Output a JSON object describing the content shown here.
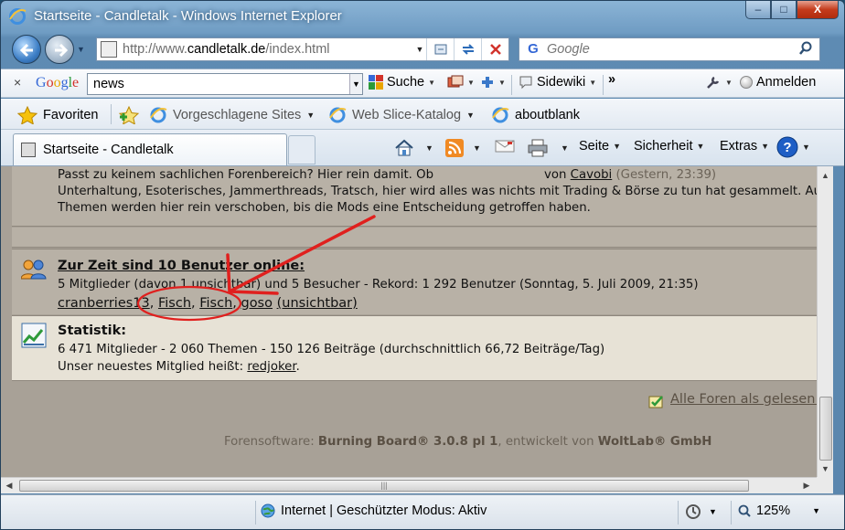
{
  "window": {
    "title": "Startseite - Candletalk - Windows Internet Explorer",
    "minimize": "–",
    "maximize": "□",
    "close": "X"
  },
  "nav": {
    "url_prefix": "http://www.",
    "url_domain": "candletalk.de",
    "url_suffix": "/index.html",
    "search_placeholder": "Google"
  },
  "google_toolbar": {
    "close": "×",
    "logo": "Google",
    "query": "news",
    "search_label": "Suche",
    "sidewiki_label": "Sidewiki",
    "more": "»",
    "signin_label": "Anmelden"
  },
  "favorites": {
    "favorites_label": "Favoriten",
    "suggested_label": "Vorgeschlagene Sites",
    "webslice_label": "Web Slice-Katalog",
    "aboutblank_label": "aboutblank"
  },
  "command_bar": {
    "tab_title": "Startseite - Candletalk",
    "page_label": "Seite",
    "safety_label": "Sicherheit",
    "extras_label": "Extras"
  },
  "forum": {
    "offtopic_desc_1": "Passt zu keinem sachlichen Forenbereich? Hier rein damit. Ob",
    "offtopic_desc_2": "Unterhaltung, Esoterisches, Jammerthreads, Tratsch, hier wird alles was nichts mit Trading & Börse zu tun hat gesammelt. Auch st",
    "offtopic_desc_3": "Themen werden hier rein verschoben, bis die Mods eine Entscheidung getroffen haben.",
    "lastpost_by": "von",
    "lastpost_user": "Cavobi",
    "lastpost_time": "(Gestern, 23:39)",
    "online_title": "Zur Zeit sind 10 Benutzer online:",
    "online_detail": "5 Mitglieder (davon 1 unsichtbar) und 5 Besucher - Rekord: 1 292 Benutzer (Sonntag, 5. Juli 2009, 21:35)",
    "online_users": [
      {
        "name": "cranberries13",
        "sep": ", "
      },
      {
        "name": "Fisch",
        "sep": ", "
      },
      {
        "name": "Fisch",
        "sep": ", "
      },
      {
        "name": "goso",
        "sep": " "
      }
    ],
    "invisible_note": "(unsichtbar)",
    "stats_title": "Statistik:",
    "stats_detail": "6 471 Mitglieder - 2 060 Themen - 150 126 Beiträge (durchschnittlich 66,72 Beiträge/Tag)",
    "newest_member_prefix": "Unser neuestes Mitglied heißt:",
    "newest_member": "redjoker",
    "newest_member_suffix": ".",
    "mark_read": "Alle Foren als gelesen m",
    "credit_prefix": "Forensoftware:",
    "credit_product": "Burning Board® 3.0.8 pl 1",
    "credit_mid": ", entwickelt von",
    "credit_company": "WoltLab® GmbH"
  },
  "status_bar": {
    "zone": "Internet | Geschützter Modus: Aktiv",
    "zoom": "125%"
  },
  "colors": {
    "annotation": "#e0201e",
    "page_bg": "#b8b1a6",
    "stats_bg": "#e7e2d6"
  }
}
